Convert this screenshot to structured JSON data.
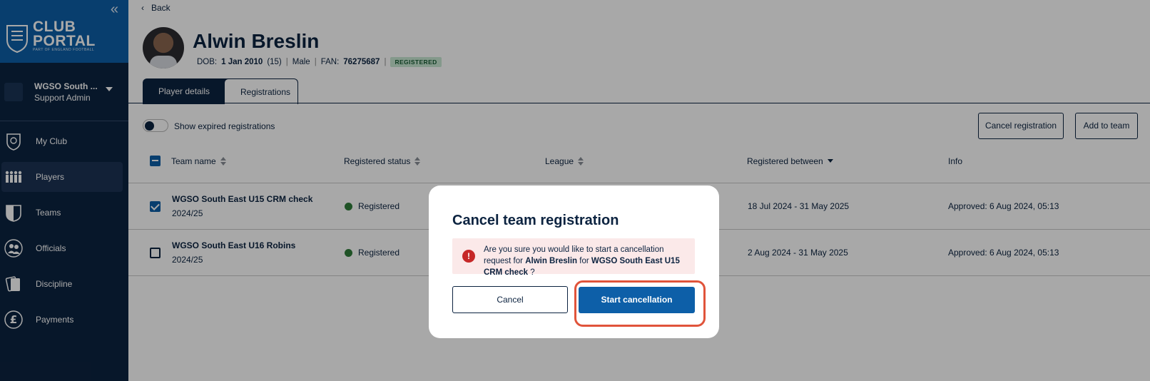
{
  "sidebar": {
    "collapse_icon": "double-chevron-left-icon",
    "logo": {
      "line1": "CLUB",
      "line2": "PORTAL",
      "sub": "PART OF ENGLAND FOOTBALL"
    },
    "account": {
      "name": "WGSO South ...",
      "role": "Support Admin"
    },
    "items": [
      {
        "label": "My Club",
        "icon": "shield-icon",
        "active": false
      },
      {
        "label": "Players",
        "icon": "players-icon",
        "active": true
      },
      {
        "label": "Teams",
        "icon": "team-shirt-icon",
        "active": false
      },
      {
        "label": "Officials",
        "icon": "officials-icon",
        "active": false
      },
      {
        "label": "Discipline",
        "icon": "cards-icon",
        "active": false
      },
      {
        "label": "Payments",
        "icon": "pound-icon",
        "active": false
      }
    ]
  },
  "header": {
    "back_label": "Back",
    "player_name": "Alwin Breslin",
    "dob_label": "DOB:",
    "dob_value": "1 Jan 2010",
    "age": "(15)",
    "gender": "Male",
    "fan_label": "FAN:",
    "fan_value": "76275687",
    "status_badge": "REGISTERED"
  },
  "tabs": [
    {
      "label": "Player details",
      "active": false
    },
    {
      "label": "Registrations",
      "active": true
    }
  ],
  "toolbar": {
    "toggle_label": "Show expired registrations",
    "cancel_registration": "Cancel registration",
    "add_to_team": "Add to team"
  },
  "table": {
    "columns": [
      "Team name",
      "Registered status",
      "League",
      "Registered between",
      "Info"
    ],
    "rows": [
      {
        "team": "WGSO South East U15 CRM check",
        "season": "2024/25",
        "status": "Registered",
        "league": "",
        "between": "18 Jul 2024 - 31 May 2025",
        "info": "Approved: 6 Aug 2024, 05:13",
        "checked": true
      },
      {
        "team": "WGSO South East U16 Robins",
        "season": "2024/25",
        "status": "Registered",
        "league": "",
        "between": "2 Aug 2024 - 31 May 2025",
        "info": "Approved: 6 Aug 2024, 05:13",
        "checked": false
      }
    ]
  },
  "modal": {
    "title": "Cancel team registration",
    "alert_prefix": "Are you sure you would like to start a cancellation request for",
    "player": "Alwin Breslin",
    "for_word": "for",
    "team": "WGSO South East U15 CRM check",
    "suffix": "?",
    "cancel_label": "Cancel",
    "start_label": "Start cancellation"
  },
  "colors": {
    "navy": "#0c2340",
    "brand_blue": "#0d5fa8",
    "success": "#2f7d3a",
    "alert_bg": "#fbe9e9",
    "highlight": "#e0543b"
  }
}
